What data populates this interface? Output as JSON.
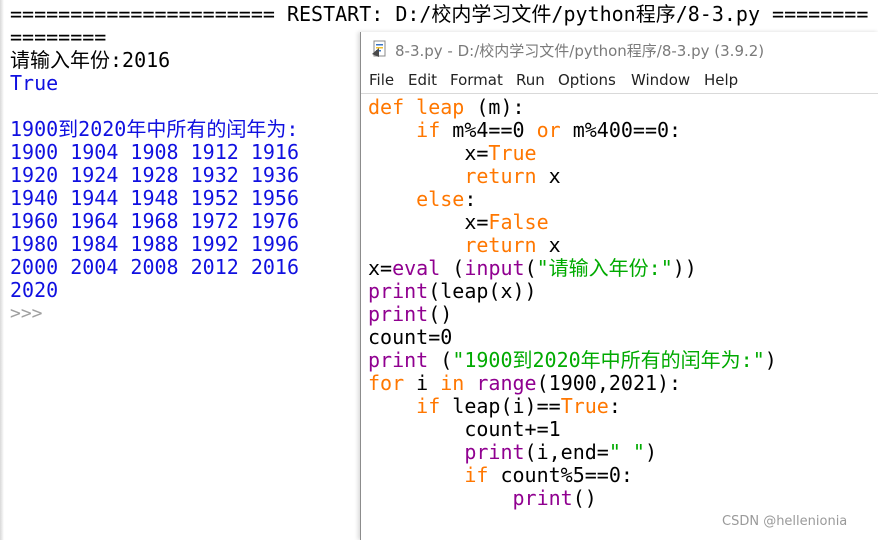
{
  "shell": {
    "lines": [
      {
        "text": "====================== RESTART: D:/校内学习文件/python程序/8-3.py ========",
        "kind": "restart"
      },
      {
        "text": "========",
        "kind": "restart"
      },
      {
        "text": "请输入年份:2016",
        "kind": "input"
      },
      {
        "text": "True",
        "kind": "out"
      },
      {
        "text": "",
        "kind": "out"
      },
      {
        "text": "1900到2020年中所有的闰年为:",
        "kind": "out"
      },
      {
        "text": "1900 1904 1908 1912 1916",
        "kind": "out"
      },
      {
        "text": "1920 1924 1928 1932 1936",
        "kind": "out"
      },
      {
        "text": "1940 1944 1948 1952 1956",
        "kind": "out"
      },
      {
        "text": "1960 1964 1968 1972 1976",
        "kind": "out"
      },
      {
        "text": "1980 1984 1988 1992 1996",
        "kind": "out"
      },
      {
        "text": "2000 2004 2008 2012 2016",
        "kind": "out"
      },
      {
        "text": "2020",
        "kind": "out"
      },
      {
        "text": ">>>",
        "kind": "prompt"
      }
    ]
  },
  "editor": {
    "title": "8-3.py - D:/校内学习文件/python程序/8-3.py (3.9.2)",
    "menu": [
      "File",
      "Edit",
      "Format",
      "Run",
      "Options",
      "Window",
      "Help"
    ],
    "code": [
      [
        [
          "def",
          "kw"
        ],
        [
          " ",
          ""
        ],
        [
          "leap",
          "kw"
        ],
        [
          " (m):",
          ""
        ]
      ],
      [
        [
          "    ",
          ""
        ],
        [
          "if",
          "kw"
        ],
        [
          " m%4==0 ",
          ""
        ],
        [
          "or",
          "kw"
        ],
        [
          " m%400==0:",
          ""
        ]
      ],
      [
        [
          "        x=",
          ""
        ],
        [
          "True",
          "kw"
        ]
      ],
      [
        [
          "        ",
          ""
        ],
        [
          "return",
          "kw"
        ],
        [
          " x",
          ""
        ]
      ],
      [
        [
          "    ",
          ""
        ],
        [
          "else",
          "kw"
        ],
        [
          ":",
          ""
        ]
      ],
      [
        [
          "        x=",
          ""
        ],
        [
          "False",
          "kw"
        ]
      ],
      [
        [
          "        ",
          ""
        ],
        [
          "return",
          "kw"
        ],
        [
          " x",
          ""
        ]
      ],
      [
        [
          "x=",
          ""
        ],
        [
          "eval",
          "bi"
        ],
        [
          " (",
          ""
        ],
        [
          "input",
          "bi"
        ],
        [
          "(",
          ""
        ],
        [
          "\"请输入年份:\"",
          "str"
        ],
        [
          "))",
          ""
        ]
      ],
      [
        [
          "print",
          "bi"
        ],
        [
          "(leap(x))",
          ""
        ]
      ],
      [
        [
          "print",
          "bi"
        ],
        [
          "()",
          ""
        ]
      ],
      [
        [
          "count=0",
          ""
        ]
      ],
      [
        [
          "print",
          "bi"
        ],
        [
          " (",
          ""
        ],
        [
          "\"1900到2020年中所有的闰年为:\"",
          "str"
        ],
        [
          ")",
          ""
        ]
      ],
      [
        [
          "for",
          "kw"
        ],
        [
          " i ",
          ""
        ],
        [
          "in",
          "kw"
        ],
        [
          " ",
          ""
        ],
        [
          "range",
          "bi"
        ],
        [
          "(1900,2021):",
          ""
        ]
      ],
      [
        [
          "    ",
          ""
        ],
        [
          "if",
          "kw"
        ],
        [
          " leap(i)==",
          ""
        ],
        [
          "True",
          "kw"
        ],
        [
          ":",
          ""
        ]
      ],
      [
        [
          "        count+=1",
          ""
        ]
      ],
      [
        [
          "        ",
          ""
        ],
        [
          "print",
          "bi"
        ],
        [
          "(i,end=",
          ""
        ],
        [
          "\" \"",
          "str"
        ],
        [
          ")",
          ""
        ]
      ],
      [
        [
          "        ",
          ""
        ],
        [
          "if",
          "kw"
        ],
        [
          " count%5==0:",
          ""
        ]
      ],
      [
        [
          "            ",
          ""
        ],
        [
          "print",
          "bi"
        ],
        [
          "()",
          ""
        ]
      ]
    ]
  },
  "watermark": "CSDN @hellenionia"
}
